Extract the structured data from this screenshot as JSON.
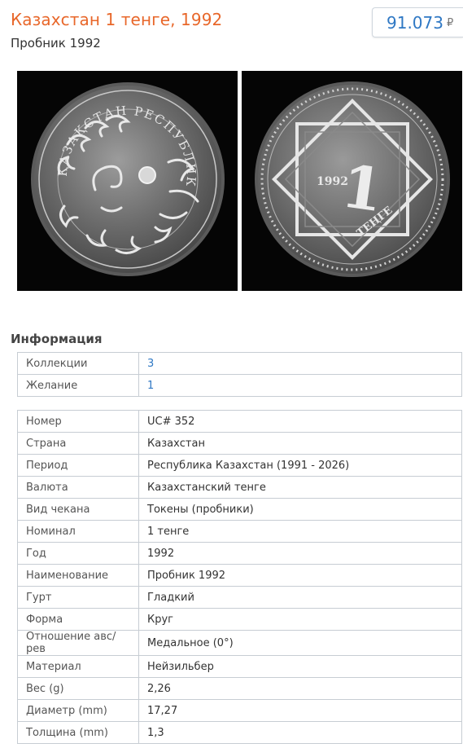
{
  "header": {
    "title": "Казахстан 1 тенге, 1992",
    "subtitle": "Пробник 1992",
    "price": "91.073",
    "currency": "₽"
  },
  "images": {
    "obverse_text": "ҚАЗАҚСТАН РЕСПУБЛИКАСЫ",
    "reverse_year": "1992",
    "reverse_denomination": "1",
    "reverse_unit": "ТЕҢГЕ"
  },
  "info": {
    "heading": "Информация",
    "collections": [
      {
        "label": "Коллекции",
        "value": "3"
      },
      {
        "label": "Желание",
        "value": "1"
      }
    ],
    "details": [
      {
        "label": "Номер",
        "value": "UC# 352"
      },
      {
        "label": "Страна",
        "value": "Казахстан"
      },
      {
        "label": "Период",
        "value": "Республика Казахстан (1991 - 2026)"
      },
      {
        "label": "Валюта",
        "value": "Казахстанский тенге"
      },
      {
        "label": "Вид чекана",
        "value": "Токены (пробники)"
      },
      {
        "label": "Номинал",
        "value": "1 тенге"
      },
      {
        "label": "Год",
        "value": "1992"
      },
      {
        "label": "Наименование",
        "value": "Пробник 1992"
      },
      {
        "label": "Гурт",
        "value": "Гладкий"
      },
      {
        "label": "Форма",
        "value": "Круг"
      },
      {
        "label": "Отношение авс/рев",
        "value": "Медальное (0°)"
      },
      {
        "label": "Материал",
        "value": "Нейзильбер"
      },
      {
        "label": "Вес (g)",
        "value": "2,26"
      },
      {
        "label": "Диаметр (mm)",
        "value": "17,27"
      },
      {
        "label": "Толщина (mm)",
        "value": "1,3"
      }
    ]
  },
  "colors": {
    "title": "#e8672a",
    "link": "#2f78c4",
    "border": "#c7cdd3"
  }
}
